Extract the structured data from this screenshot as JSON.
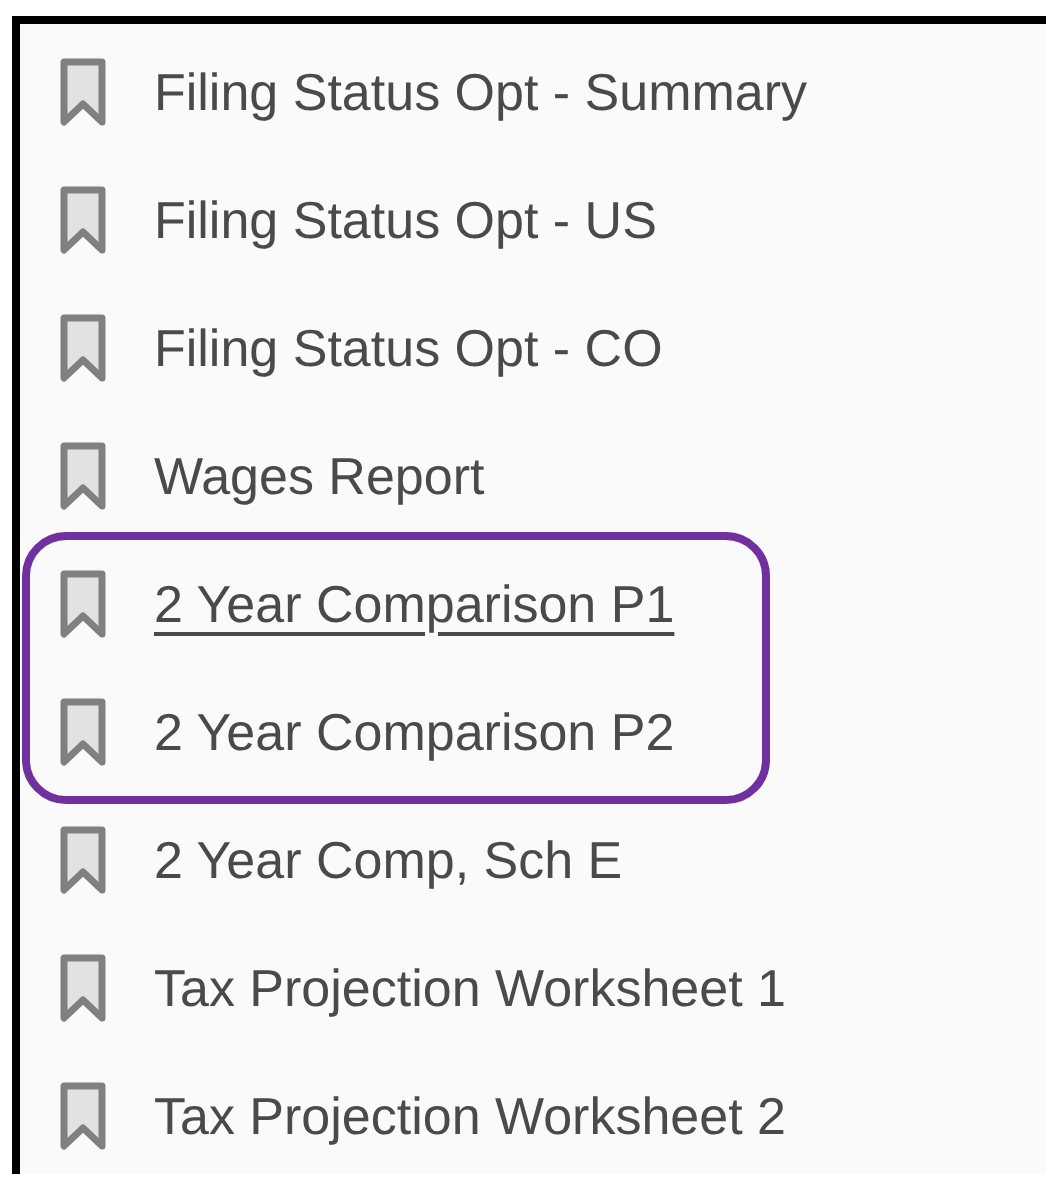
{
  "bookmarks": [
    {
      "kind": "bookmark",
      "label": "Filing Status Opt - Summary",
      "hovered": false
    },
    {
      "kind": "bookmark",
      "label": "Filing Status Opt - US",
      "hovered": false
    },
    {
      "kind": "bookmark",
      "label": "Filing Status Opt - CO",
      "hovered": false
    },
    {
      "kind": "bookmark",
      "label": "Wages Report",
      "hovered": false
    },
    {
      "kind": "highlight",
      "items": [
        {
          "kind": "bookmark",
          "label": "2 Year Comparison P1",
          "hovered": true
        },
        {
          "kind": "bookmark",
          "label": "2 Year Comparison P2",
          "hovered": false
        }
      ]
    },
    {
      "kind": "bookmark",
      "label": "2 Year Comp, Sch E",
      "hovered": false
    },
    {
      "kind": "bookmark",
      "label": "Tax Projection Worksheet 1",
      "hovered": false
    },
    {
      "kind": "bookmark",
      "label": "Tax Projection Worksheet 2",
      "hovered": false
    }
  ]
}
